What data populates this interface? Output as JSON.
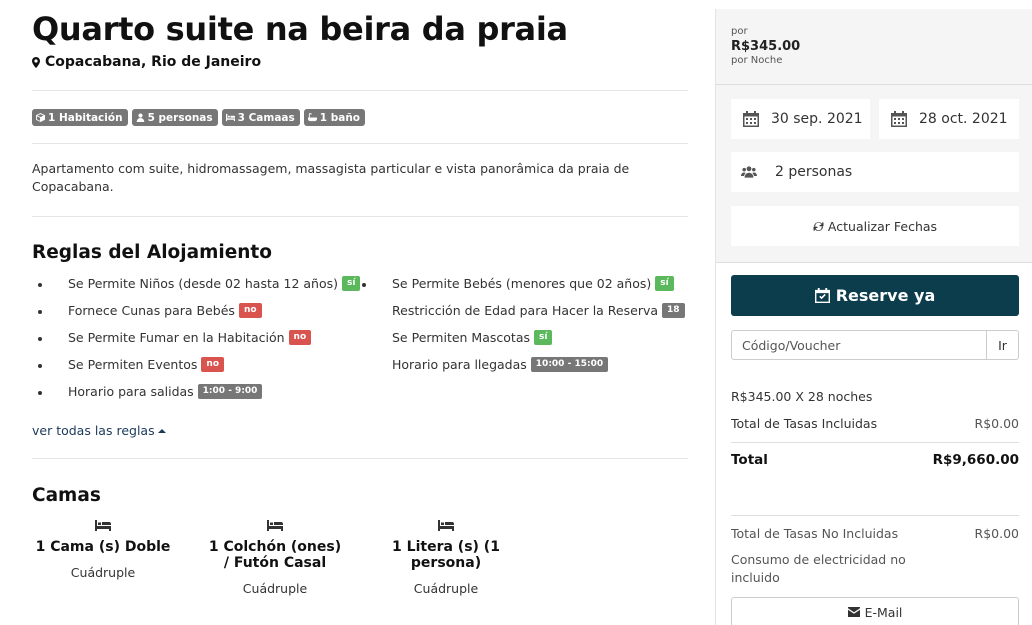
{
  "listing": {
    "title": "Quarto suite na beira da praia",
    "location": "Copacabana, Rio de Janeiro",
    "tags": [
      "1 Habitación",
      "5 personas",
      "3 Camaas",
      "1 baño"
    ],
    "description": "Apartamento com suite, hidromassagem, massagista particular e vista panorâmica da praia de Copacabana."
  },
  "rules": {
    "heading": "Reglas del Alojamiento",
    "left": [
      {
        "label": "Se Permite Niños (desde 02 hasta 12 años)",
        "badge": "sí",
        "badge_color": "#5cb85c"
      },
      {
        "label": "Fornece Cunas para Bebés",
        "badge": "no",
        "badge_color": "#d9534f"
      },
      {
        "label": "Se Permite Fumar en la Habitación",
        "badge": "no",
        "badge_color": "#d9534f"
      },
      {
        "label": "Se Permiten Eventos",
        "badge": "no",
        "badge_color": "#d9534f"
      },
      {
        "label": "Horario para salidas",
        "badge": "1:00 - 9:00",
        "badge_color": "#777777"
      }
    ],
    "right": [
      {
        "label": "Se Permite Bebés (menores que 02 años)",
        "badge": "sí",
        "badge_color": "#5cb85c"
      },
      {
        "label": "Restricción de Edad para Hacer la Reserva",
        "badge": "18",
        "badge_color": "#777777"
      },
      {
        "label": "Se Permiten Mascotas",
        "badge": "sí",
        "badge_color": "#5cb85c"
      },
      {
        "label": "Horario para llegadas",
        "badge": "10:00 - 15:00",
        "badge_color": "#777777"
      }
    ],
    "see_all": "ver todas las reglas"
  },
  "beds": {
    "heading": "Camas",
    "items": [
      {
        "name": "1 Cama (s) Doble",
        "type": "Cuádruple"
      },
      {
        "name": "1 Colchón (ones) / Futón Casal",
        "type": "Cuádruple"
      },
      {
        "name": "1 Litera (s) (1 persona)",
        "type": "Cuádruple"
      }
    ]
  },
  "booking": {
    "per_label": "por",
    "price": "R$345.00",
    "per_night": "por Noche",
    "check_in": "30 sep. 2021",
    "check_out": "28 oct. 2021",
    "guests": "2 personas",
    "refresh_label": "Actualizar Fechas",
    "reserve_label": "Reserve ya",
    "voucher_placeholder": "Código/Voucher",
    "ir_label": "Ir",
    "breakdown": "R$345.00 X 28 noches",
    "taxes_included_label": "Total de Tasas Incluidas",
    "taxes_included_value": "R$0.00",
    "total_label": "Total",
    "total_value": "R$9,660.00",
    "taxes_excluded_label": "Total de Tasas No Incluidas",
    "taxes_excluded_value": "R$0.00",
    "note": "Consumo de electricidad no incluido",
    "email_label": "E-Mail",
    "accent": "#0b3d4c"
  }
}
